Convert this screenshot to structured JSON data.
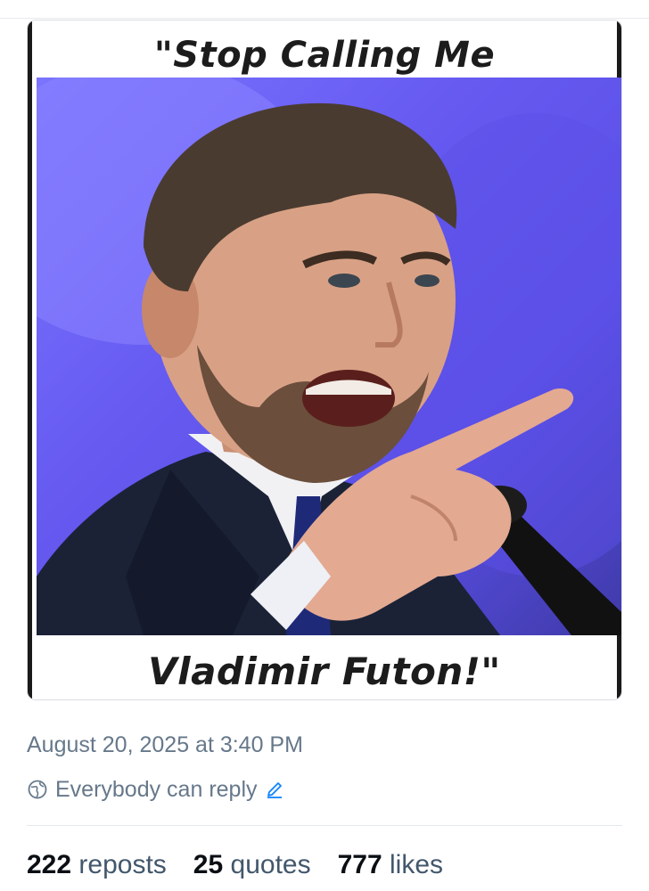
{
  "media": {
    "caption_top": "\"Stop Calling Me",
    "caption_bottom": "Vladimir Futon!\""
  },
  "post": {
    "timestamp": "August 20, 2025 at 3:40 PM",
    "reply_setting": "Everybody can reply",
    "reply_icon": "globe-icon",
    "edit_icon": "pencil-icon"
  },
  "stats": [
    {
      "count": "222",
      "label": "reposts"
    },
    {
      "count": "25",
      "label": "quotes"
    },
    {
      "count": "777",
      "label": "likes"
    }
  ],
  "colors": {
    "muted_text": "#66788a",
    "link_blue": "#1083fe",
    "photo_background": "#6b62f5"
  }
}
